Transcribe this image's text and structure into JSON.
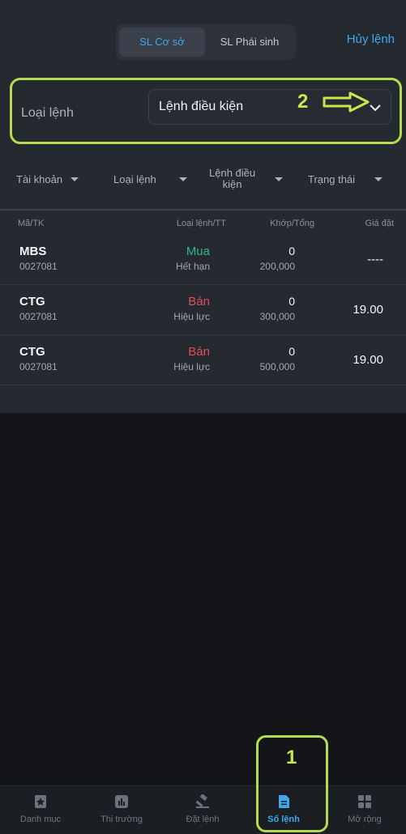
{
  "header": {
    "tab_active": "SL Cơ sở",
    "tab_inactive": "SL Phái sinh",
    "cancel_label": "Hủy lệnh"
  },
  "order_type": {
    "label": "Loại lệnh",
    "value": "Lệnh điều kiện",
    "chevron_icon": "chevron-down-icon"
  },
  "annotations": {
    "marker_2": "2",
    "marker_1": "1",
    "arrow_icon": "arrow-right-outline-icon",
    "highlight_color": "#b5dc4a"
  },
  "filters": [
    {
      "label": "Tài khoản"
    },
    {
      "label": "Loại lệnh"
    },
    {
      "label_line1": "Lệnh điều",
      "label_line2": "kiện"
    },
    {
      "label": "Trạng thái"
    }
  ],
  "table": {
    "headers": [
      "Mã/TK",
      "Loại lệnh/TT",
      "Khớp/Tổng",
      "Giá đặt"
    ],
    "rows": [
      {
        "symbol": "MBS",
        "account": "0027081",
        "side": "Mua",
        "status": "Hết hạn",
        "matched": "0",
        "total": "200,000",
        "price": "----"
      },
      {
        "symbol": "CTG",
        "account": "0027081",
        "side": "Bán",
        "status": "Hiệu lực",
        "matched": "0",
        "total": "300,000",
        "price": "19.00"
      },
      {
        "symbol": "CTG",
        "account": "0027081",
        "side": "Bán",
        "status": "Hiệu lực",
        "matched": "0",
        "total": "500,000",
        "price": "19.00"
      }
    ]
  },
  "bottom_nav": [
    {
      "label": "Danh mục",
      "icon": "bookmark-icon"
    },
    {
      "label": "Thị trường",
      "icon": "bar-chart-icon"
    },
    {
      "label": "Đặt lệnh",
      "icon": "gavel-icon"
    },
    {
      "label": "Sổ lệnh",
      "icon": "document-icon",
      "active": true
    },
    {
      "label": "Mở rộng",
      "icon": "grid-icon"
    }
  ],
  "colors": {
    "accent": "#3fa7ee",
    "buy": "#2fb98a",
    "sell": "#e34a5b"
  }
}
